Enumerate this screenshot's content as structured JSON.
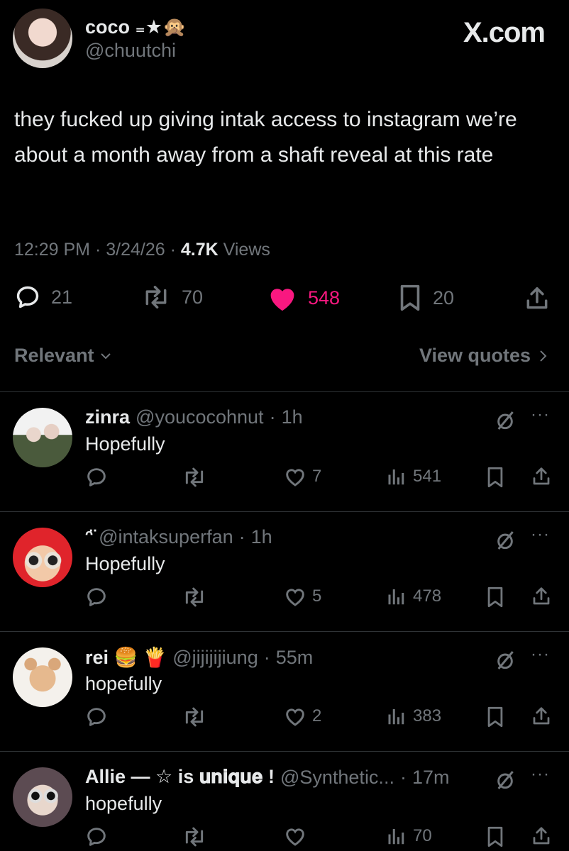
{
  "watermark": "X.com",
  "author": {
    "display_name": "coco ₌★🙊",
    "handle": "@chuutchi"
  },
  "tweet": {
    "text": "they fucked up giving intak access to instagram we’re about a month away from a shaft reveal at this rate",
    "time": "12:29 PM",
    "date": "3/24/26",
    "views_count": "4.7K",
    "views_label": "Views",
    "replies": "21",
    "reposts": "70",
    "likes": "548",
    "bookmarks": "20"
  },
  "colors": {
    "like_accent": "#f91880",
    "muted": "#71767b",
    "text": "#e7e9ea"
  },
  "filter": {
    "sort_label": "Relevant",
    "quotes_label": "View quotes"
  },
  "replies": [
    {
      "name": "zinra",
      "handle": "@youcocohnut",
      "time": "1h",
      "text": "Hopefully",
      "likes": "7",
      "views": "541"
    },
    {
      "name": "ᵔ̈",
      "handle": "@intaksuperfan",
      "time": "1h",
      "text": "Hopefully",
      "likes": "5",
      "views": "478"
    },
    {
      "name": "rei 🍔 🍟",
      "handle": "@jijijijiung",
      "time": "55m",
      "text": "hopefully",
      "likes": "2",
      "views": "383"
    },
    {
      "name": "Allie — ☆ is 𝐮𝐧𝐢𝐪𝐮𝐞 !",
      "handle": "@Synthetic...",
      "time": "17m",
      "text": "hopefully",
      "likes": "",
      "views": "70"
    }
  ]
}
